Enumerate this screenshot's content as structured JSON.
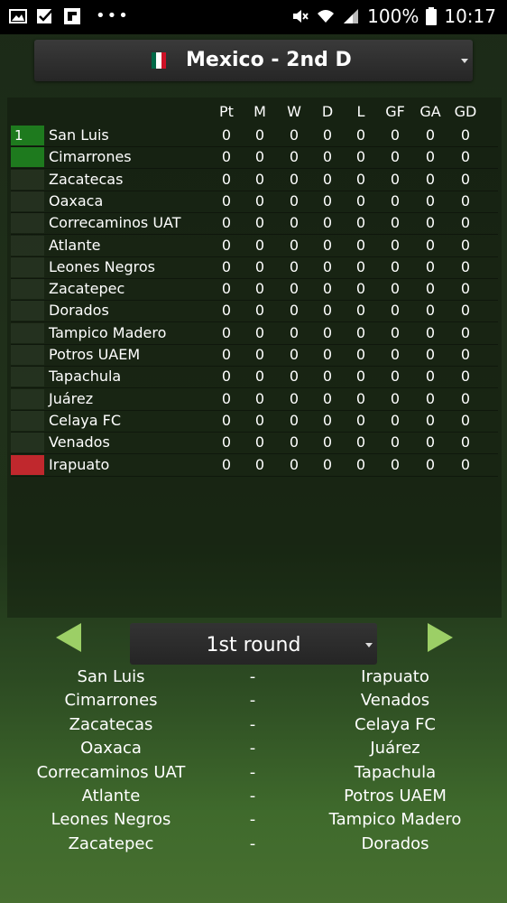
{
  "status_bar": {
    "battery": "100%",
    "time": "10:17",
    "icons": [
      "image-icon",
      "checkbox-icon",
      "flipboard-icon",
      "more-dots-icon",
      "mute-icon",
      "wifi-icon",
      "signal-icon",
      "battery-icon"
    ]
  },
  "league": {
    "title": "Mexico - 2nd D",
    "flag_colors": [
      "#006847",
      "#ffffff",
      "#ce1126"
    ]
  },
  "table": {
    "columns": [
      "Pt",
      "M",
      "W",
      "D",
      "L",
      "GF",
      "GA",
      "GD"
    ],
    "rows": [
      {
        "pos": "1",
        "team": "San Luis",
        "marker": "#1e7a1e",
        "values": [
          "0",
          "0",
          "0",
          "0",
          "0",
          "0",
          "0",
          "0"
        ]
      },
      {
        "pos": "",
        "team": "Cimarrones",
        "marker": "#1e7a1e",
        "values": [
          "0",
          "0",
          "0",
          "0",
          "0",
          "0",
          "0",
          "0"
        ]
      },
      {
        "pos": "",
        "team": "Zacatecas",
        "marker": "",
        "values": [
          "0",
          "0",
          "0",
          "0",
          "0",
          "0",
          "0",
          "0"
        ]
      },
      {
        "pos": "",
        "team": "Oaxaca",
        "marker": "",
        "values": [
          "0",
          "0",
          "0",
          "0",
          "0",
          "0",
          "0",
          "0"
        ]
      },
      {
        "pos": "",
        "team": "Correcaminos UAT",
        "marker": "",
        "values": [
          "0",
          "0",
          "0",
          "0",
          "0",
          "0",
          "0",
          "0"
        ]
      },
      {
        "pos": "",
        "team": "Atlante",
        "marker": "",
        "values": [
          "0",
          "0",
          "0",
          "0",
          "0",
          "0",
          "0",
          "0"
        ]
      },
      {
        "pos": "",
        "team": "Leones Negros",
        "marker": "",
        "values": [
          "0",
          "0",
          "0",
          "0",
          "0",
          "0",
          "0",
          "0"
        ]
      },
      {
        "pos": "",
        "team": "Zacatepec",
        "marker": "",
        "values": [
          "0",
          "0",
          "0",
          "0",
          "0",
          "0",
          "0",
          "0"
        ]
      },
      {
        "pos": "",
        "team": "Dorados",
        "marker": "",
        "values": [
          "0",
          "0",
          "0",
          "0",
          "0",
          "0",
          "0",
          "0"
        ]
      },
      {
        "pos": "",
        "team": "Tampico Madero",
        "marker": "",
        "values": [
          "0",
          "0",
          "0",
          "0",
          "0",
          "0",
          "0",
          "0"
        ]
      },
      {
        "pos": "",
        "team": "Potros UAEM",
        "marker": "",
        "values": [
          "0",
          "0",
          "0",
          "0",
          "0",
          "0",
          "0",
          "0"
        ]
      },
      {
        "pos": "",
        "team": "Tapachula",
        "marker": "",
        "values": [
          "0",
          "0",
          "0",
          "0",
          "0",
          "0",
          "0",
          "0"
        ]
      },
      {
        "pos": "",
        "team": "Juárez",
        "marker": "",
        "values": [
          "0",
          "0",
          "0",
          "0",
          "0",
          "0",
          "0",
          "0"
        ]
      },
      {
        "pos": "",
        "team": "Celaya FC",
        "marker": "",
        "values": [
          "0",
          "0",
          "0",
          "0",
          "0",
          "0",
          "0",
          "0"
        ]
      },
      {
        "pos": "",
        "team": "Venados",
        "marker": "",
        "values": [
          "0",
          "0",
          "0",
          "0",
          "0",
          "0",
          "0",
          "0"
        ]
      },
      {
        "pos": "",
        "team": "Irapuato",
        "marker": "#c0282d",
        "values": [
          "0",
          "0",
          "0",
          "0",
          "0",
          "0",
          "0",
          "0"
        ]
      }
    ]
  },
  "round": {
    "label": "1st round",
    "arrow_color": "#9ccf66"
  },
  "matches": [
    {
      "home": "San Luis",
      "sep": "-",
      "away": "Irapuato"
    },
    {
      "home": "Cimarrones",
      "sep": "-",
      "away": "Venados"
    },
    {
      "home": "Zacatecas",
      "sep": "-",
      "away": "Celaya FC"
    },
    {
      "home": "Oaxaca",
      "sep": "-",
      "away": "Juárez"
    },
    {
      "home": "Correcaminos UAT",
      "sep": "-",
      "away": "Tapachula"
    },
    {
      "home": "Atlante",
      "sep": "-",
      "away": "Potros UAEM"
    },
    {
      "home": "Leones Negros",
      "sep": "-",
      "away": "Tampico Madero"
    },
    {
      "home": "Zacatepec",
      "sep": "-",
      "away": "Dorados"
    }
  ]
}
